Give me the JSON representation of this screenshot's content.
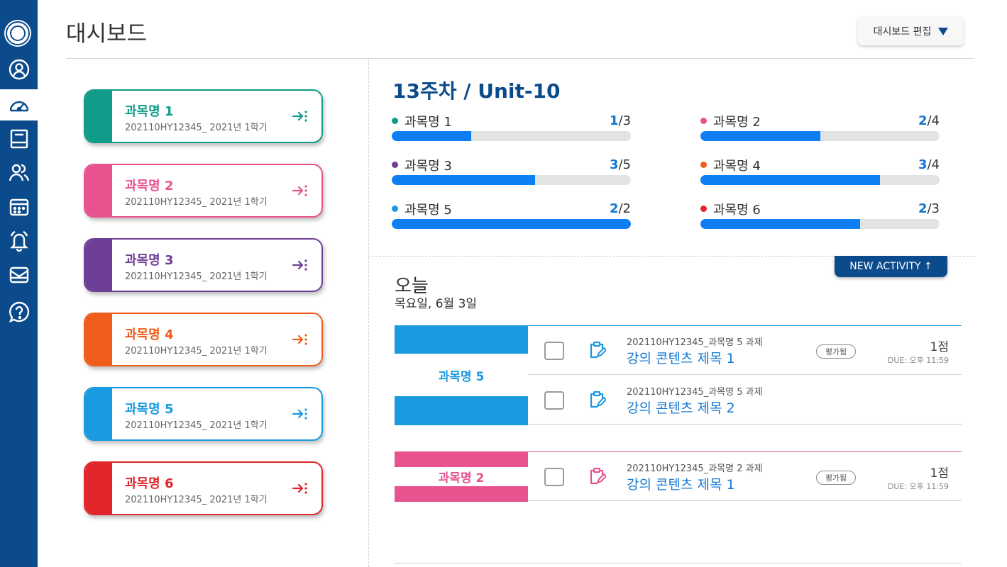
{
  "header": {
    "title": "대시보드",
    "edit_button": "대시보드 편집"
  },
  "sidebar": {
    "icons": [
      "university-logo",
      "profile-icon",
      "dashboard-icon",
      "courses-icon",
      "people-icon",
      "calendar-icon",
      "notification-icon",
      "inbox-icon",
      "help-icon"
    ],
    "active": "dashboard-icon"
  },
  "courses": [
    {
      "name": "과목명 1",
      "code": "202110HY12345_ 2021년 1학기",
      "color": "#109c88"
    },
    {
      "name": "과목명 2",
      "code": "202110HY12345_ 2021년 1학기",
      "color": "#e8528f"
    },
    {
      "name": "과목명 3",
      "code": "202110HY12345_ 2021년 1학기",
      "color": "#6e3f96"
    },
    {
      "name": "과목명 4",
      "code": "202110HY12345_ 2021년 1학기",
      "color": "#f05d1a"
    },
    {
      "name": "과목명 5",
      "code": "202110HY12345_ 2021년 1학기",
      "color": "#1a9ae0"
    },
    {
      "name": "과목명 6",
      "code": "202110HY12345_ 2021년 1학기",
      "color": "#e0262a"
    }
  ],
  "progress": {
    "title": "13주차 / Unit-10",
    "items": [
      {
        "name": "과목명 1",
        "done": "1",
        "total": "/3",
        "fraction": 0.333,
        "color": "#109c88"
      },
      {
        "name": "과목명 2",
        "done": "2",
        "total": "/4",
        "fraction": 0.5,
        "color": "#e8528f"
      },
      {
        "name": "과목명 3",
        "done": "3",
        "total": "/5",
        "fraction": 0.6,
        "color": "#6e3f96"
      },
      {
        "name": "과목명 4",
        "done": "3",
        "total": "/4",
        "fraction": 0.75,
        "color": "#f05d1a"
      },
      {
        "name": "과목명 5",
        "done": "2",
        "total": "/2",
        "fraction": 1.0,
        "color": "#1a9ae0"
      },
      {
        "name": "과목명 6",
        "done": "2",
        "total": "/3",
        "fraction": 0.667,
        "color": "#e0262a"
      }
    ]
  },
  "today": {
    "new_activity": "NEW ACTIVITY ↑",
    "title": "오늘",
    "date": "목요일, 6월 3일",
    "groups": [
      {
        "course": "과목명 5",
        "color": "#1a9ae0",
        "activities": [
          {
            "sub": "202110HY12345_과목명 5 과제",
            "title": "강의 콘텐츠 제목 1",
            "badge": "평가됨",
            "score": "1점",
            "due": "DUE: 오후 11:59"
          },
          {
            "sub": "202110HY12345_과목명 5 과제",
            "title": "강의 콘텐츠 제목 2",
            "badge": "",
            "score": "",
            "due": ""
          }
        ]
      },
      {
        "course": "과목명 2",
        "color": "#e8528f",
        "activities": [
          {
            "sub": "202110HY12345_과목명 2 과제",
            "title": "강의 콘텐츠 제목 1",
            "badge": "평가됨",
            "score": "1점",
            "due": "DUE: 오후 11:59"
          }
        ]
      }
    ]
  }
}
